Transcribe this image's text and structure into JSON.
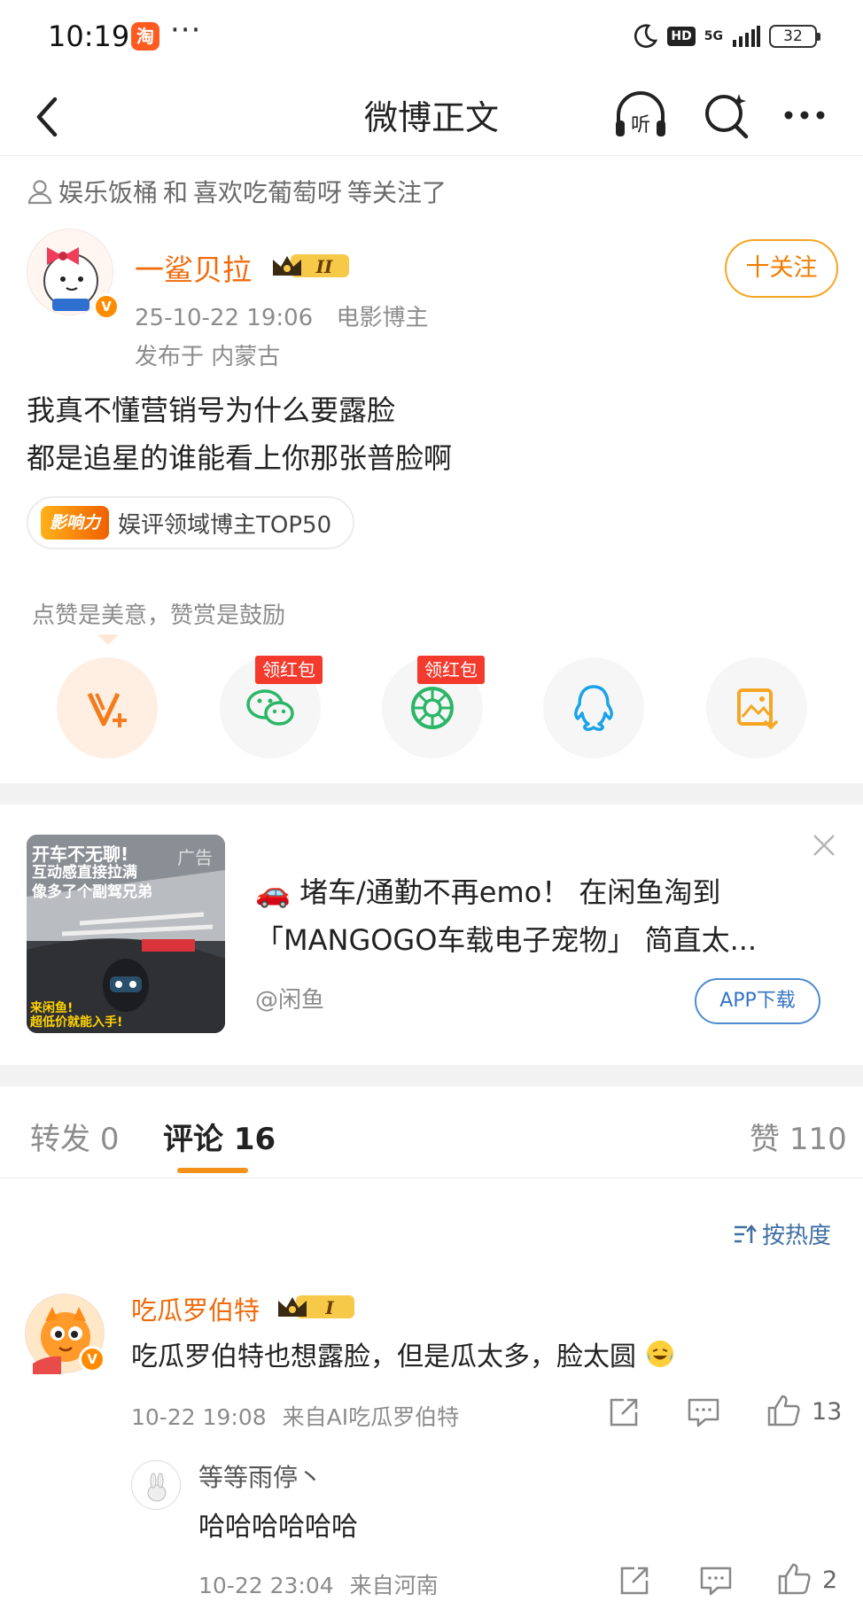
{
  "status_bar": {
    "time": "10:19",
    "app_icon": "淘",
    "dots": "···",
    "network": "5G",
    "hd": "HD",
    "battery": "32"
  },
  "nav": {
    "title": "微博正文",
    "back_icon": "back-arrow-icon",
    "listen_icon": "headphone-listen-icon",
    "search_icon": "search-icon",
    "more_icon": "more-dots-icon"
  },
  "follow_hint": {
    "user1": "娱乐饭桶",
    "conj": "和",
    "user2": "喜欢吃葡萄呀",
    "tail": "等关注了"
  },
  "author": {
    "name": "一鲨贝拉",
    "level": "II",
    "date": "25-10-22 19:06",
    "role": "电影博主",
    "location": "发布于 内蒙古",
    "follow_label": "十关注"
  },
  "post": {
    "line1": "我真不懂营销号为什么要露脸",
    "line2": "都是追星的谁能看上你那张普脸啊"
  },
  "influence": {
    "badge": "影响力",
    "text": "娱评领域博主TOP50"
  },
  "reward": {
    "hint": "点赞是美意，赞赏是鼓励",
    "buttons": [
      {
        "icon": "reward-v-icon"
      },
      {
        "icon": "wechat-icon",
        "tag": "领红包"
      },
      {
        "icon": "moments-icon",
        "tag": "领红包"
      },
      {
        "icon": "qq-icon"
      },
      {
        "icon": "save-image-icon"
      }
    ]
  },
  "ad": {
    "label": "广告",
    "overlay_title": "开车不无聊!",
    "overlay_line1": "互动感直接拉满",
    "overlay_line2": "像多了个副驾兄弟",
    "overlay_bottom1": "来闲鱼!",
    "overlay_bottom2": "超低价就能入手!",
    "text": "🚗 堵车/通勤不再emo！ 在闲鱼淘到「MANGOGO车载电子宠物」 简直太...",
    "source": "@闲鱼",
    "download": "APP下载"
  },
  "tabs": {
    "repost_label": "转发",
    "repost_count": "0",
    "comment_label": "评论",
    "comment_count": "16",
    "like_label": "赞",
    "like_count": "110"
  },
  "sort_label": "按热度",
  "comments": [
    {
      "name": "吃瓜罗伯特",
      "level": "I",
      "text": "吃瓜罗伯特也想露脸，但是瓜太多，脸太圆",
      "time": "10-22 19:08",
      "source": "来自AI吃瓜罗伯特",
      "likes": "13"
    }
  ],
  "reply": {
    "name": "等等雨停丶",
    "text": "哈哈哈哈哈哈",
    "time": "10-22 23:04",
    "source": "来自河南",
    "likes": "2"
  },
  "colors": {
    "accent": "#f06b0c",
    "link": "#3f6fa3",
    "tab_underline": "#f5901a",
    "red_tag": "#f33a2d"
  }
}
